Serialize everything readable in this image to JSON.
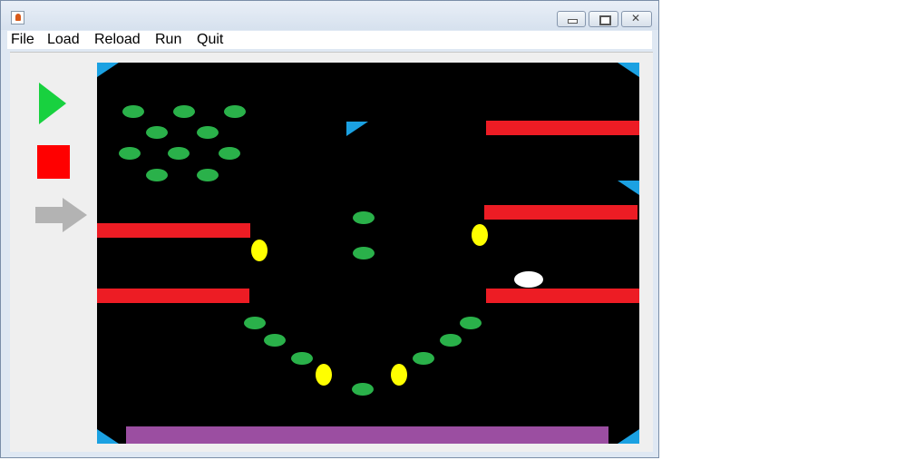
{
  "menu": {
    "file": "File",
    "load": "Load",
    "reload": "Reload",
    "run": "Run",
    "quit": "Quit"
  },
  "icons": {
    "app": "java-app-icon",
    "minimize": "minimize-icon",
    "maximize": "maximize-icon",
    "close": "close-icon",
    "play": "play-icon",
    "stop": "stop-icon",
    "step": "step-arrow-icon"
  },
  "colors": {
    "play": "#18d13f",
    "stop": "#ff0000",
    "step": "#b3b3b3",
    "board": "#000000",
    "bumper": "#2ab14a",
    "wall": "#ed1c24",
    "flipper": "#ffff00",
    "ball": "#ffffff",
    "triangle": "#1ba1e2",
    "absorber": "#9b4ea1"
  }
}
